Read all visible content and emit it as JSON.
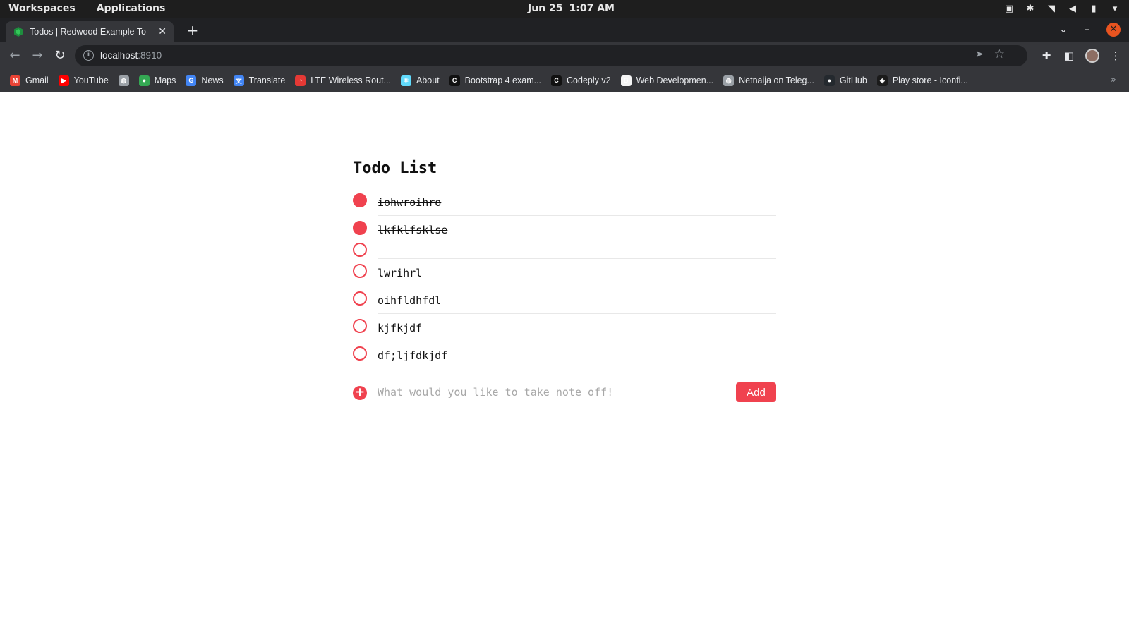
{
  "system_bar": {
    "workspaces": "Workspaces",
    "applications": "Applications",
    "date": "Jun 25",
    "time": "1:07 AM"
  },
  "browser": {
    "tab_title": "Todos | Redwood Example To",
    "url_host": "localhost",
    "url_port": ":8910",
    "bookmarks": [
      {
        "label": "Gmail",
        "icon": "gmail-icon",
        "color": "#ea4335",
        "glyph": "M"
      },
      {
        "label": "YouTube",
        "icon": "youtube-icon",
        "color": "#ff0000",
        "glyph": "▶"
      },
      {
        "label": "",
        "icon": "globe-icon",
        "color": "#9aa0a6",
        "glyph": "◍"
      },
      {
        "label": "Maps",
        "icon": "maps-icon",
        "color": "#34a853",
        "glyph": "●"
      },
      {
        "label": "News",
        "icon": "news-icon",
        "color": "#4285f4",
        "glyph": "G"
      },
      {
        "label": "Translate",
        "icon": "translate-icon",
        "color": "#4285f4",
        "glyph": "文"
      },
      {
        "label": "LTE Wireless Rout...",
        "icon": "router-icon",
        "color": "#e53935",
        "glyph": "◔"
      },
      {
        "label": "About",
        "icon": "react-icon",
        "color": "#61dafb",
        "glyph": "⚛"
      },
      {
        "label": "Bootstrap 4 exam...",
        "icon": "codeply-icon",
        "color": "#111111",
        "glyph": "C"
      },
      {
        "label": "Codeply v2",
        "icon": "codeply-icon",
        "color": "#111111",
        "glyph": "C"
      },
      {
        "label": "Web Developmen...",
        "icon": "web-dev-icon",
        "color": "#f5f5f5",
        "glyph": "B"
      },
      {
        "label": "Netnaija on Teleg...",
        "icon": "globe-icon",
        "color": "#9aa0a6",
        "glyph": "◍"
      },
      {
        "label": "GitHub",
        "icon": "github-icon",
        "color": "#24292e",
        "glyph": "●"
      },
      {
        "label": "Play store - Iconfi...",
        "icon": "iconfinder-icon",
        "color": "#1b1b1b",
        "glyph": "◈"
      }
    ]
  },
  "todo": {
    "title": "Todo List",
    "items": [
      {
        "text": "iohwroihro",
        "done": true
      },
      {
        "text": "lkfklfsklse",
        "done": true
      },
      {
        "text": "",
        "done": false
      },
      {
        "text": "lwrihrl",
        "done": false
      },
      {
        "text": "oihfldhfdl",
        "done": false
      },
      {
        "text": "kjfkjdf",
        "done": false
      },
      {
        "text": "df;ljfdkjdf",
        "done": false
      }
    ],
    "input_placeholder": "What would you like to take note off!",
    "input_value": "",
    "add_label": "Add"
  },
  "colors": {
    "accent": "#f0424f"
  }
}
